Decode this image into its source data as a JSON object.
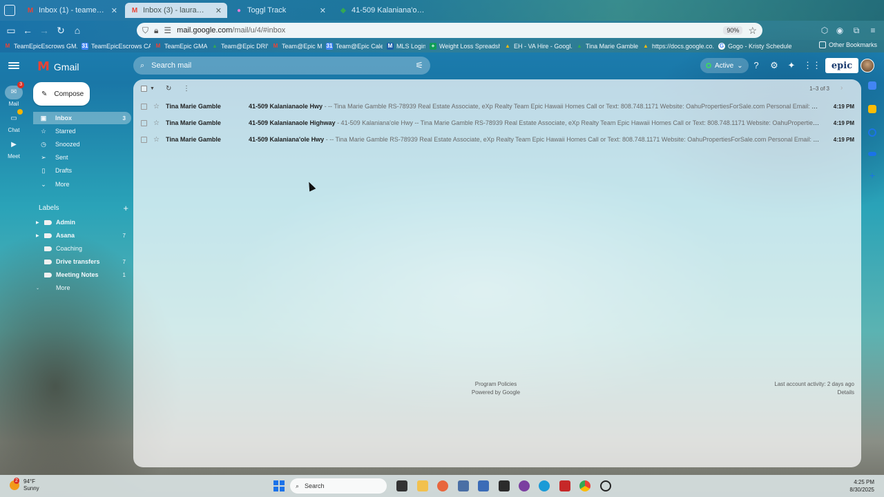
{
  "browser": {
    "tabs": [
      {
        "label": "Inbox (1) - teamepicescrows@g",
        "favicon": "gmail-icon",
        "active": false
      },
      {
        "label": "Inbox (3) - laura@epichawaiiho",
        "favicon": "gmail-icon",
        "active": true
      },
      {
        "label": "Toggl Track",
        "favicon": "toggl-icon",
        "active": false
      },
      {
        "label": "41-509 Kalaniana'ole Hwy - Go",
        "favicon": "maps-icon",
        "active": false
      }
    ],
    "url_host": "mail.google.com",
    "url_path": "/mail/u/4/#inbox",
    "zoom": "90%",
    "bookmarks": [
      {
        "label": "TeamEpicEscrows GM...",
        "icon": "gmail-icon",
        "color": "#ea4335"
      },
      {
        "label": "TeamEpicEscrows CAL...",
        "icon": "calendar-icon",
        "color": "#4285f4"
      },
      {
        "label": "TeamEpic GMAIL",
        "icon": "gmail-icon",
        "color": "#ea4335"
      },
      {
        "label": "Team@Epic DRIVE",
        "icon": "drive-icon",
        "color": "#34a853"
      },
      {
        "label": "Team@Epic Mail",
        "icon": "gmail-icon",
        "color": "#ea4335"
      },
      {
        "label": "Team@Epic Calendar",
        "icon": "calendar-icon",
        "color": "#4285f4"
      },
      {
        "label": "MLS Login",
        "icon": "mls-icon",
        "color": "#1b5fa8"
      },
      {
        "label": "Weight Loss Spreadsh...",
        "icon": "sheets-icon",
        "color": "#0f9d58"
      },
      {
        "label": "EH - VA Hire - Googl...",
        "icon": "drive-icon",
        "color": "#fbbc04"
      },
      {
        "label": "Tina Marie Gamble -...",
        "icon": "drive-icon",
        "color": "#34a853"
      },
      {
        "label": "https://docs.google.co...",
        "icon": "drive-icon",
        "color": "#fbbc04"
      },
      {
        "label": "Gogo - Kristy Scheduler",
        "icon": "google-icon",
        "color": "#4285f4"
      }
    ],
    "other_bookmarks": "Other Bookmarks"
  },
  "gmail": {
    "product": "Gmail",
    "search_placeholder": "Search mail",
    "status": "Active",
    "brand_logo_text": "epic",
    "compose": "Compose",
    "rail": [
      {
        "label": "Mail",
        "badge": "3"
      },
      {
        "label": "Chat",
        "badge": ""
      },
      {
        "label": "Meet",
        "badge": ""
      }
    ],
    "nav": [
      {
        "label": "Inbox",
        "count": "3",
        "icon": "inbox-icon"
      },
      {
        "label": "Starred",
        "count": "",
        "icon": "star-icon"
      },
      {
        "label": "Snoozed",
        "count": "",
        "icon": "clock-icon"
      },
      {
        "label": "Sent",
        "count": "",
        "icon": "send-icon"
      },
      {
        "label": "Drafts",
        "count": "",
        "icon": "draft-icon"
      },
      {
        "label": "More",
        "count": "",
        "icon": "chevron-down-icon"
      }
    ],
    "labels_title": "Labels",
    "labels": [
      {
        "name": "Admin",
        "count": "",
        "bold": true
      },
      {
        "name": "Asana",
        "count": "7",
        "bold": true
      },
      {
        "name": "Coaching",
        "count": "",
        "bold": false
      },
      {
        "name": "Drive transfers",
        "count": "7",
        "bold": true
      },
      {
        "name": "Meeting Notes",
        "count": "1",
        "bold": true
      },
      {
        "name": "More",
        "count": "",
        "bold": false
      }
    ],
    "pager": "1–3 of 3",
    "emails": [
      {
        "sender": "Tina Marie Gamble",
        "subject": "41-509 Kalanianaole Hwy",
        "snippet": " - -- Tina Marie Gamble RS-78939 Real Estate Associate, eXp Realty Team Epic Hawaii Homes Call or Text: 808.748.1171 Website: OahuPropertiesForSale.com Personal Email: TinaMarie@Epic...",
        "time": "4:19 PM"
      },
      {
        "sender": "Tina Marie Gamble",
        "subject": "41-509 Kalanianaole Highway",
        "snippet": " - 41-509 Kalaniana'ole Hwy -- Tina Marie Gamble RS-78939 Real Estate Associate, eXp Realty Team Epic Hawaii Homes Call or Text: 808.748.1171 Website: OahuPropertiesForSale.com ...",
        "time": "4:19 PM"
      },
      {
        "sender": "Tina Marie Gamble",
        "subject": "41-509 Kalaniana'ole Hwy",
        "snippet": " - -- Tina Marie Gamble RS-78939 Real Estate Associate, eXp Realty Team Epic Hawaii Homes Call or Text: 808.748.1171 Website: OahuPropertiesForSale.com Personal Email: TinaMarie@Epi...",
        "time": "4:19 PM"
      }
    ],
    "footer": {
      "program_policies": "Program Policies",
      "powered_by": "Powered by Google",
      "last_activity": "Last account activity: 2 days ago",
      "details": "Details"
    }
  },
  "taskbar": {
    "weather_temp": "94°F",
    "weather_desc": "Sunny",
    "weather_badge": "2",
    "search": "Search",
    "time": "4:25 PM",
    "date": "8/30/2025"
  }
}
